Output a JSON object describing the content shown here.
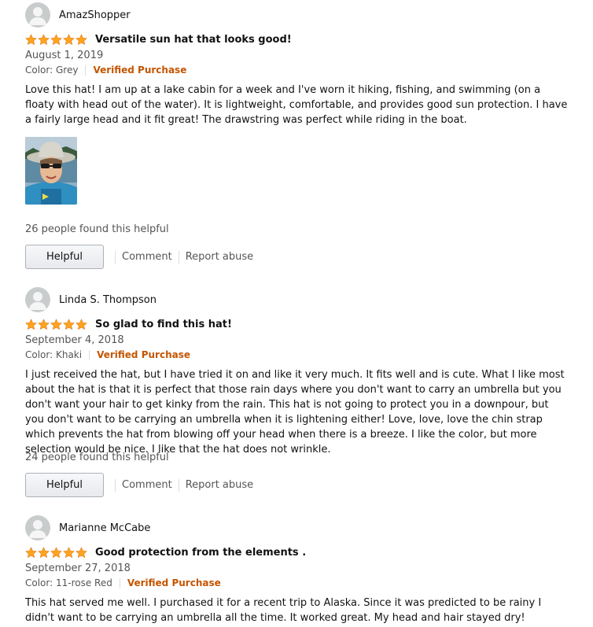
{
  "reviews": [
    {
      "author": "AmazShopper",
      "rating": 5,
      "title": "Versatile sun hat that looks good!",
      "date": "August 1, 2019",
      "color": "Color: Grey",
      "verified": "Verified Purchase",
      "body": "Love this hat! I am up at a lake cabin for a week and I've worn it hiking, fishing, and swimming (on a floaty with head out of the water). It is lightweight, comfortable, and provides good sun protection. I have a fairly large head and it fit great! The drawstring was perfect while riding in the boat.",
      "helpful_count": "26 people found this helpful",
      "helpful_label": "Helpful",
      "comment_label": "Comment",
      "report_label": "Report abuse"
    },
    {
      "author": "Linda S. Thompson",
      "rating": 5,
      "title": "So glad to find this hat!",
      "date": "September 4, 2018",
      "color": "Color: Khaki",
      "verified": "Verified Purchase",
      "body": "I just received the hat, but I have tried it on and like it very much. It fits well and is cute. What I like most about the hat is that it is perfect that those rain days where you don't want to carry an umbrella but you don't want your hair to get kinky from the rain. This hat is not going to protect you in a downpour, but you don't want to be carrying an umbrella when it is lightening either! Love, love, love the chin strap which prevents the hat from blowing off your head when there is a breeze. I like the color, but more selection would be nice. I like that the hat does not wrinkle.",
      "helpful_count": "24 people found this helpful",
      "helpful_label": "Helpful",
      "comment_label": "Comment",
      "report_label": "Report abuse"
    },
    {
      "author": "Marianne McCabe",
      "rating": 5,
      "title": "Good protection from the elements .",
      "date": "September 27, 2018",
      "color": "Color: 11-rose Red",
      "verified": "Verified Purchase",
      "body": "This hat served me well. I purchased it for a recent trip to Alaska. Since it was predicted to be rainy I didn't want to be carrying an umbrella all the time. It worked great. My head and hair stayed dry!"
    }
  ],
  "colors": {
    "star": "#ffa41c",
    "verified": "#c45500",
    "secondary_text": "#555555"
  }
}
